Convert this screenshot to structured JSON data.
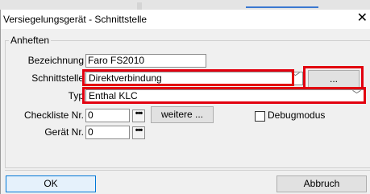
{
  "window": {
    "title": "Versiegelungsgerät - Schnittstelle",
    "close_glyph": "✕"
  },
  "group": {
    "label": "Anheften"
  },
  "fields": {
    "bezeichnung": {
      "label": "Bezeichnung",
      "value": "Faro FS2010"
    },
    "schnittstelle": {
      "label": "Schnittstelle",
      "value": "Direktverbindung",
      "browse_label": "..."
    },
    "typ": {
      "label": "Typ",
      "value": "Enthal KLC"
    },
    "checkliste": {
      "label": "Checkliste Nr.",
      "value": "0",
      "more_label": "•••",
      "weitere_label": "weitere ..."
    },
    "geraet": {
      "label": "Gerät Nr.",
      "value": "0",
      "more_label": "•••"
    },
    "debug": {
      "label": "Debugmodus",
      "checked": false
    }
  },
  "buttons": {
    "ok": "OK",
    "cancel": "Abbruch"
  },
  "icons": {
    "chevron": "﹀"
  },
  "highlight_color": "#e2000f"
}
